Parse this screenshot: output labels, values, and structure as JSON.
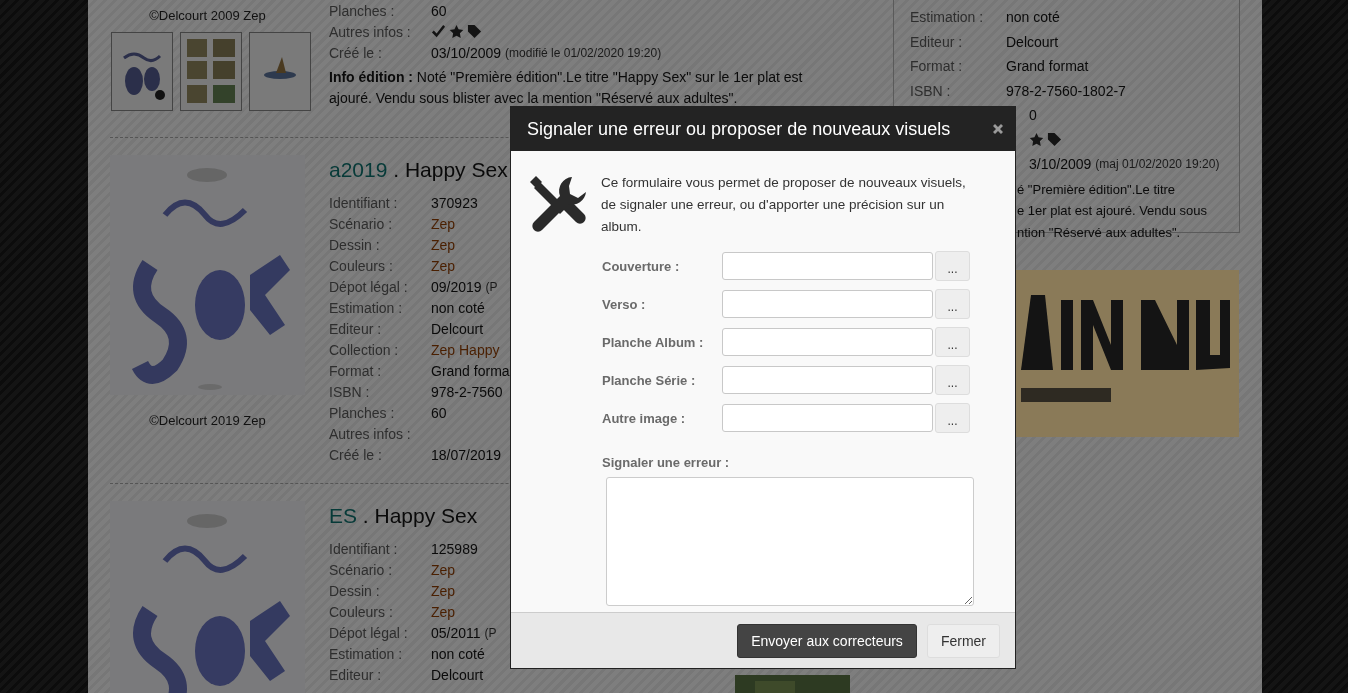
{
  "entries": [
    {
      "copyright": "©Delcourt 2009 Zep",
      "thumbnails": [
        {
          "kind": "picture"
        },
        {
          "kind": "picture"
        },
        {
          "kind": "picture"
        }
      ],
      "fields": [
        {
          "label": "Planches :",
          "kind": "text",
          "value": "60"
        },
        {
          "label": "Autres infos :",
          "kind": "icons",
          "icons": [
            {
              "kind": "check"
            },
            {
              "kind": "star"
            },
            {
              "kind": "tag"
            }
          ]
        },
        {
          "label": "Créé le :",
          "kind": "text",
          "value": "03/10/2009",
          "note": "(modifié le 01/02/2020 19:20)"
        }
      ],
      "info": "**Info édition :** Noté \"Première édition\".Le titre \"Happy Sex\" sur le 1er plat est ajouré. Vendu sous blister avec la mention \"Réservé aux adultes\"."
    },
    {
      "code": "a2019",
      "title": " . Happy Sex",
      "cover": {
        "kind": "picture"
      },
      "copyright": "©Delcourt 2019 Zep",
      "fields": [
        {
          "label": "Identifiant :",
          "kind": "text",
          "value": "370923"
        },
        {
          "label": "Scénario :",
          "kind": "link",
          "value": "Zep"
        },
        {
          "label": "Dessin :",
          "kind": "link",
          "value": "Zep"
        },
        {
          "label": "Couleurs :",
          "kind": "link",
          "value": "Zep"
        },
        {
          "label": "Dépot légal :",
          "kind": "text",
          "value": "09/2019",
          "note": "(P"
        },
        {
          "label": "Estimation :",
          "kind": "text",
          "value": "non coté"
        },
        {
          "label": "Editeur :",
          "kind": "text",
          "value": "Delcourt"
        },
        {
          "label": "Collection :",
          "kind": "link",
          "value": "Zep Happy"
        },
        {
          "label": "Format :",
          "kind": "text",
          "value": "Grand forma"
        },
        {
          "label": "ISBN :",
          "kind": "text",
          "value": "978-2-7560"
        },
        {
          "label": "Planches :",
          "kind": "text",
          "value": "60"
        },
        {
          "label": "Autres infos :",
          "kind": "text"
        },
        {
          "label": "Créé le :",
          "kind": "text",
          "value": "18/07/2019"
        }
      ]
    },
    {
      "code": "ES",
      "title": " . Happy Sex",
      "cover": {
        "kind": "picture"
      },
      "fields": [
        {
          "label": "Identifiant :",
          "kind": "text",
          "value": "125989"
        },
        {
          "label": "Scénario :",
          "kind": "link",
          "value": "Zep"
        },
        {
          "label": "Dessin :",
          "kind": "link",
          "value": "Zep"
        },
        {
          "label": "Couleurs :",
          "kind": "link",
          "value": "Zep"
        },
        {
          "label": "Dépot légal :",
          "kind": "text",
          "value": "05/2011",
          "note": "(P"
        },
        {
          "label": "Estimation :",
          "kind": "text",
          "value": "non coté"
        },
        {
          "label": "Editeur :",
          "kind": "text",
          "value": "Delcourt"
        }
      ]
    }
  ],
  "side_panel": {
    "fields": [
      {
        "label": "Estimation :",
        "kind": "text",
        "value": "non coté"
      },
      {
        "label": "Editeur :",
        "kind": "text",
        "value": "Delcourt"
      },
      {
        "label": "Format :",
        "kind": "text",
        "value": "Grand format"
      },
      {
        "label": "ISBN :",
        "kind": "text",
        "value": "978-2-7560-1802-7"
      }
    ],
    "partial_rows": [
      {
        "kind": "text",
        "value": "0"
      },
      {
        "kind": "icons",
        "icons": [
          {
            "kind": "star"
          },
          {
            "kind": "tag"
          }
        ]
      },
      {
        "kind": "text",
        "value": "3/10/2009",
        "note": "(maj 01/02/2020 19:20)"
      }
    ],
    "info_fragments": [
      "é \"Première édition\".Le titre",
      "e 1er plat est ajouré. Vendu sous",
      "ntion \"Réservé aux adultes\"."
    ],
    "banner": {
      "kind": "picture"
    }
  },
  "modal": {
    "title": "Signaler une erreur ou proposer de nouveaux visuels",
    "intro": "Ce formulaire vous permet de proposer de nouveaux visuels, de signaler une erreur, ou d'apporter une précision sur un album.",
    "fields": [
      {
        "label": "Couverture :",
        "button": "..."
      },
      {
        "label": "Verso :",
        "button": "..."
      },
      {
        "label": "Planche Album :",
        "button": "..."
      },
      {
        "label": "Planche Série :",
        "button": "..."
      },
      {
        "label": "Autre image :",
        "button": "..."
      }
    ],
    "comment_label": "Signaler une erreur :",
    "buttons": [
      {
        "label": "Envoyer aux correcteurs",
        "kind": "primary"
      },
      {
        "label": "Fermer",
        "kind": "default"
      }
    ]
  }
}
